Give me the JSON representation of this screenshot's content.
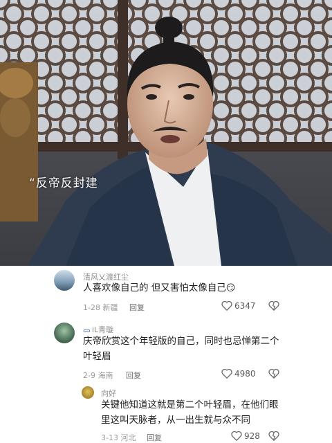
{
  "video": {
    "subtitle": "“反帝反封建"
  },
  "comments": [
    {
      "username": "清风乂渡红尘",
      "text": "人喜欢像自己的 但又害怕太像自己",
      "emoji": "😏",
      "date": "1-28",
      "location": "新疆",
      "reply_label": "回复",
      "likes": "6347"
    },
    {
      "username_badge": "ᯅ",
      "username": "iL青璇",
      "text_line1": "庆帝欣赏这个年轻版的自己，同时也忌惮第二个",
      "text_line2": "叶轻眉",
      "date": "2-9",
      "location": "海南",
      "reply_label": "回复",
      "likes": "4980"
    },
    {
      "username": "向好",
      "text_line1": "关键他知道这就是第二个叶轻眉，在他们眼",
      "text_line2": "里这叫天脉者，从一出生就与众不同",
      "date": "3-13",
      "location": "河北",
      "reply_label": "回复",
      "likes": "928"
    }
  ],
  "icons": {
    "like": "heart-outline-icon",
    "dislike": "broken-heart-icon"
  },
  "colors": {
    "comment_text": "#1f1f1f",
    "meta_text": "#9a9a9a",
    "username_text": "#8a8a8a"
  }
}
